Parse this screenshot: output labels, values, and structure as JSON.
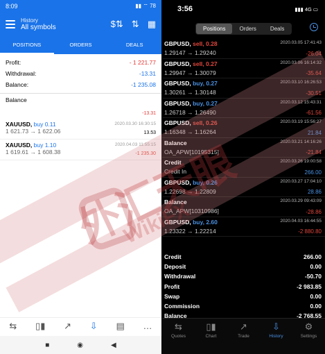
{
  "android": {
    "status_time": "8:09",
    "status_icons": "▮▮ ⌔ 78",
    "header_title": "History",
    "header_sub": "All symbols",
    "tabs": [
      "POSITIONS",
      "ORDERS",
      "DEALS"
    ],
    "summary": [
      {
        "label": "Profit:",
        "value": "- 1 221.77"
      },
      {
        "label": "Withdrawal:",
        "value": "-13.31"
      },
      {
        "label": "Balance:",
        "value": "-1 235.08"
      }
    ],
    "balance_row": {
      "label": "Balance",
      "value": "-13.31"
    },
    "positions": [
      {
        "symbol": "XAUUSD,",
        "side": "buy 0.11",
        "price": "1 621.73 → 1 622.06",
        "date": "2020.03.30 16:30:15",
        "pl": "13.53"
      },
      {
        "symbol": "XAUUSD,",
        "side": "buy 1.10",
        "price": "1 619.61 → 1 608.38",
        "date": "2020.04.03 11:55:15",
        "pl": "-1 235.30"
      }
    ],
    "nav": [
      "⇆",
      "▯▮",
      "↗",
      "⇩",
      "▤",
      "…"
    ],
    "sys": [
      "■",
      "◉",
      "◀"
    ]
  },
  "ios": {
    "status_time": "3:56",
    "status_icons": "▮▮▮ 4G ▭",
    "seg": [
      "Positions",
      "Orders",
      "Deals"
    ],
    "items": [
      {
        "kind": "trade",
        "sym": "GBPUSD,",
        "side": "sell, 0.28",
        "dir": "sell",
        "price": "1.29147 → 1.29240",
        "date": "2020.03.05 17:41:43",
        "pl": "-26.04",
        "sign": "neg"
      },
      {
        "kind": "trade",
        "sym": "GBPUSD,",
        "side": "sell, 0.27",
        "dir": "sell",
        "price": "1.29947 → 1.30079",
        "date": "2020.03.06 16:14:32",
        "pl": "-35.64",
        "sign": "neg"
      },
      {
        "kind": "trade",
        "sym": "GBPUSD,",
        "side": "buy, 0.27",
        "dir": "buy",
        "price": "1.30261 → 1.30148",
        "date": "2020.03.10 16:26:53",
        "pl": "-30.51",
        "sign": "neg"
      },
      {
        "kind": "trade",
        "sym": "GBPUSD,",
        "side": "buy, 0.27",
        "dir": "buy",
        "price": "1.26718 → 1.26490",
        "date": "2020.03.12 15:43:31",
        "pl": "-61.56",
        "sign": "neg"
      },
      {
        "kind": "trade",
        "sym": "GBPUSD,",
        "side": "sell, 0.26",
        "dir": "sell",
        "price": "1.16348 → 1.16264",
        "date": "2020.03.19 15:56:27",
        "pl": "21.84",
        "sign": "pos"
      },
      {
        "kind": "text",
        "title": "Balance",
        "line2": "OA_APW[10195315]",
        "date": "2020.03.21 14:16:26",
        "pl": "-21.84",
        "sign": "neg"
      },
      {
        "kind": "text",
        "title": "Credit",
        "line2": "Credit In",
        "date": "2020.03.26 19:00:58",
        "pl": "266.00",
        "sign": "pos"
      },
      {
        "kind": "trade",
        "sym": "GBPUSD,",
        "side": "buy, 0.26",
        "dir": "buy",
        "price": "1.22698 → 1.22809",
        "date": "2020.03.27 17:04:10",
        "pl": "28.86",
        "sign": "pos"
      },
      {
        "kind": "text",
        "title": "Balance",
        "line2": "OA_APW[10310986]",
        "date": "2020.03.29 09:43:09",
        "pl": "-28.86",
        "sign": "neg"
      },
      {
        "kind": "trade",
        "sym": "GBPUSD,",
        "side": "buy, 2.60",
        "dir": "buy",
        "price": "1.23322 → 1.22214",
        "date": "2020.04.03 16:44:55",
        "pl": "-2 880.80",
        "sign": "neg"
      }
    ],
    "summary": [
      {
        "label": "Credit",
        "value": "266.00"
      },
      {
        "label": "Deposit",
        "value": "0.00"
      },
      {
        "label": "Withdrawal",
        "value": "-50.70"
      },
      {
        "label": "Profit",
        "value": "-2 983.85"
      },
      {
        "label": "Swap",
        "value": "0.00"
      },
      {
        "label": "Commission",
        "value": "0.00"
      },
      {
        "label": "Balance",
        "value": "-2 768.55"
      }
    ],
    "nav": [
      {
        "label": "Quotes",
        "glyph": "⇆"
      },
      {
        "label": "Chart",
        "glyph": "▯▮"
      },
      {
        "label": "Trade",
        "glyph": "↗"
      },
      {
        "label": "History",
        "glyph": "⇩"
      },
      {
        "label": "Settings",
        "glyph": "⚙"
      }
    ]
  },
  "watermark": {
    "text": "外汇天眼",
    "brand": "WikiFX"
  },
  "colors": {
    "android_blue": "#1a73e8",
    "loss_red": "#e53935",
    "ios_blue": "#4a90e2"
  }
}
